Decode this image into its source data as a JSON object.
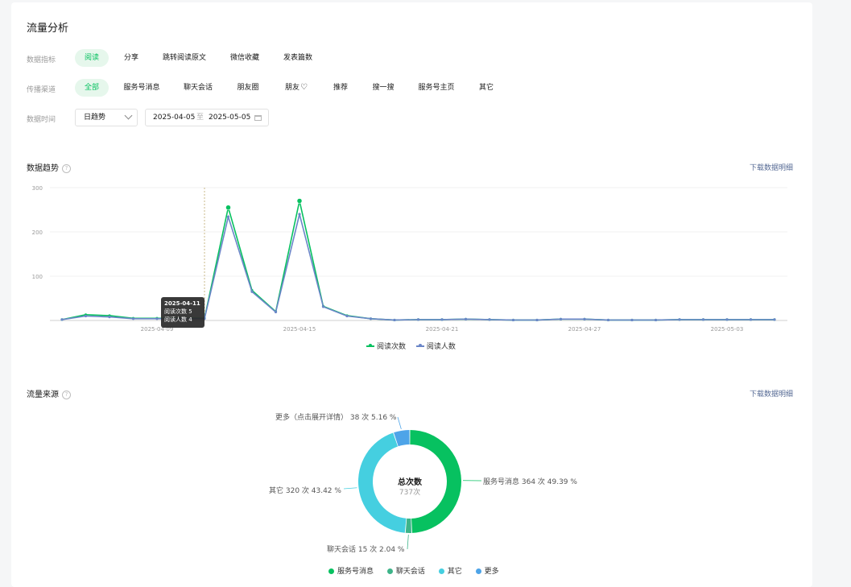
{
  "page": {
    "title": "流量分析"
  },
  "filters": {
    "metric": {
      "label": "数据指标",
      "options": [
        "阅读",
        "分享",
        "跳转阅读原文",
        "微信收藏",
        "发表篇数"
      ],
      "selected": "阅读"
    },
    "channel": {
      "label": "传播渠道",
      "options": [
        "全部",
        "服务号消息",
        "聊天会话",
        "朋友圈",
        "朋友",
        "推荐",
        "搜一搜",
        "服务号主页",
        "其它"
      ],
      "heart_suffix_on": "朋友",
      "selected": "全部"
    },
    "time": {
      "label": "数据时间",
      "granularity": "日趋势",
      "start": "2025-04-05",
      "separator": "至",
      "end": "2025-05-05"
    }
  },
  "trend": {
    "title": "数据趋势",
    "download": "下载数据明细",
    "tooltip": {
      "date": "2025-04-11",
      "line1": "阅读次数 5",
      "line2": "阅读人数 4"
    },
    "legend": [
      "阅读次数",
      "阅读人数"
    ]
  },
  "source": {
    "title": "流量来源",
    "download": "下载数据明细",
    "center_title": "总次数",
    "center_value": "737次",
    "labels": {
      "service": "服务号消息 364 次 49.39 %",
      "chat": "聊天会话 15 次 2.04 %",
      "other": "其它 320 次 43.42 %",
      "more": "更多（点击展开详情） 38 次 5.16 %"
    },
    "legend": [
      "服务号消息",
      "聊天会话",
      "其它",
      "更多"
    ]
  },
  "colors": {
    "green": "#07c160",
    "teal": "#3eb489",
    "cyan": "#45cfe0",
    "blue": "#4ea4e8",
    "read_people_line": "#6b86c8"
  },
  "chart_data": [
    {
      "type": "line",
      "title": "",
      "x": [
        "2025-04-05",
        "2025-04-06",
        "2025-04-07",
        "2025-04-08",
        "2025-04-09",
        "2025-04-10",
        "2025-04-11",
        "2025-04-12",
        "2025-04-13",
        "2025-04-14",
        "2025-04-15",
        "2025-04-16",
        "2025-04-17",
        "2025-04-18",
        "2025-04-19",
        "2025-04-20",
        "2025-04-21",
        "2025-04-22",
        "2025-04-23",
        "2025-04-24",
        "2025-04-25",
        "2025-04-26",
        "2025-04-27",
        "2025-04-28",
        "2025-04-29",
        "2025-04-30",
        "2025-05-01",
        "2025-05-02",
        "2025-05-03",
        "2025-05-04",
        "2025-05-05"
      ],
      "x_tick_labels": [
        "2025-04-09",
        "2025-04-15",
        "2025-04-21",
        "2025-04-27",
        "2025-05-03"
      ],
      "ylim": [
        0,
        300
      ],
      "y_ticks": [
        100,
        200,
        300
      ],
      "grid": true,
      "legend_position": "bottom",
      "series": [
        {
          "name": "阅读次数",
          "color": "#07c160",
          "values": [
            2,
            13,
            11,
            5,
            5,
            5,
            5,
            255,
            68,
            20,
            270,
            32,
            11,
            4,
            1,
            2,
            2,
            3,
            2,
            1,
            1,
            3,
            3,
            1,
            1,
            1,
            2,
            2,
            2,
            2,
            2
          ]
        },
        {
          "name": "阅读人数",
          "color": "#6b86c8",
          "values": [
            2,
            10,
            8,
            4,
            4,
            4,
            4,
            234,
            65,
            19,
            240,
            31,
            10,
            4,
            1,
            2,
            2,
            3,
            2,
            1,
            1,
            3,
            3,
            1,
            1,
            1,
            2,
            2,
            2,
            2,
            2
          ]
        }
      ]
    },
    {
      "type": "pie",
      "title": "",
      "categories": [
        "服务号消息",
        "聊天会话",
        "其它",
        "更多"
      ],
      "values": [
        364,
        15,
        320,
        38
      ],
      "percentages": [
        49.39,
        2.04,
        43.42,
        5.16
      ],
      "colors": [
        "#07c160",
        "#3eb489",
        "#45cfe0",
        "#4ea4e8"
      ],
      "legend_position": "bottom"
    }
  ]
}
